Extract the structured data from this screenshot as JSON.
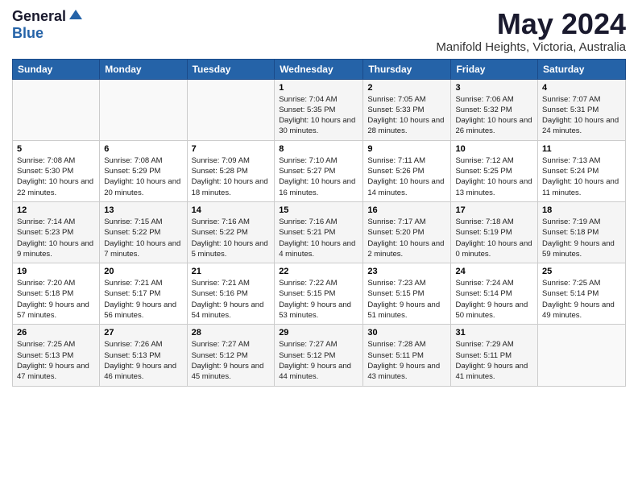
{
  "header": {
    "logo_general": "General",
    "logo_blue": "Blue",
    "month_title": "May 2024",
    "location": "Manifold Heights, Victoria, Australia"
  },
  "days_of_week": [
    "Sunday",
    "Monday",
    "Tuesday",
    "Wednesday",
    "Thursday",
    "Friday",
    "Saturday"
  ],
  "weeks": [
    [
      {
        "date": "",
        "info": ""
      },
      {
        "date": "",
        "info": ""
      },
      {
        "date": "",
        "info": ""
      },
      {
        "date": "1",
        "info": "Sunrise: 7:04 AM\nSunset: 5:35 PM\nDaylight: 10 hours and 30 minutes."
      },
      {
        "date": "2",
        "info": "Sunrise: 7:05 AM\nSunset: 5:33 PM\nDaylight: 10 hours and 28 minutes."
      },
      {
        "date": "3",
        "info": "Sunrise: 7:06 AM\nSunset: 5:32 PM\nDaylight: 10 hours and 26 minutes."
      },
      {
        "date": "4",
        "info": "Sunrise: 7:07 AM\nSunset: 5:31 PM\nDaylight: 10 hours and 24 minutes."
      }
    ],
    [
      {
        "date": "5",
        "info": "Sunrise: 7:08 AM\nSunset: 5:30 PM\nDaylight: 10 hours and 22 minutes."
      },
      {
        "date": "6",
        "info": "Sunrise: 7:08 AM\nSunset: 5:29 PM\nDaylight: 10 hours and 20 minutes."
      },
      {
        "date": "7",
        "info": "Sunrise: 7:09 AM\nSunset: 5:28 PM\nDaylight: 10 hours and 18 minutes."
      },
      {
        "date": "8",
        "info": "Sunrise: 7:10 AM\nSunset: 5:27 PM\nDaylight: 10 hours and 16 minutes."
      },
      {
        "date": "9",
        "info": "Sunrise: 7:11 AM\nSunset: 5:26 PM\nDaylight: 10 hours and 14 minutes."
      },
      {
        "date": "10",
        "info": "Sunrise: 7:12 AM\nSunset: 5:25 PM\nDaylight: 10 hours and 13 minutes."
      },
      {
        "date": "11",
        "info": "Sunrise: 7:13 AM\nSunset: 5:24 PM\nDaylight: 10 hours and 11 minutes."
      }
    ],
    [
      {
        "date": "12",
        "info": "Sunrise: 7:14 AM\nSunset: 5:23 PM\nDaylight: 10 hours and 9 minutes."
      },
      {
        "date": "13",
        "info": "Sunrise: 7:15 AM\nSunset: 5:22 PM\nDaylight: 10 hours and 7 minutes."
      },
      {
        "date": "14",
        "info": "Sunrise: 7:16 AM\nSunset: 5:22 PM\nDaylight: 10 hours and 5 minutes."
      },
      {
        "date": "15",
        "info": "Sunrise: 7:16 AM\nSunset: 5:21 PM\nDaylight: 10 hours and 4 minutes."
      },
      {
        "date": "16",
        "info": "Sunrise: 7:17 AM\nSunset: 5:20 PM\nDaylight: 10 hours and 2 minutes."
      },
      {
        "date": "17",
        "info": "Sunrise: 7:18 AM\nSunset: 5:19 PM\nDaylight: 10 hours and 0 minutes."
      },
      {
        "date": "18",
        "info": "Sunrise: 7:19 AM\nSunset: 5:18 PM\nDaylight: 9 hours and 59 minutes."
      }
    ],
    [
      {
        "date": "19",
        "info": "Sunrise: 7:20 AM\nSunset: 5:18 PM\nDaylight: 9 hours and 57 minutes."
      },
      {
        "date": "20",
        "info": "Sunrise: 7:21 AM\nSunset: 5:17 PM\nDaylight: 9 hours and 56 minutes."
      },
      {
        "date": "21",
        "info": "Sunrise: 7:21 AM\nSunset: 5:16 PM\nDaylight: 9 hours and 54 minutes."
      },
      {
        "date": "22",
        "info": "Sunrise: 7:22 AM\nSunset: 5:15 PM\nDaylight: 9 hours and 53 minutes."
      },
      {
        "date": "23",
        "info": "Sunrise: 7:23 AM\nSunset: 5:15 PM\nDaylight: 9 hours and 51 minutes."
      },
      {
        "date": "24",
        "info": "Sunrise: 7:24 AM\nSunset: 5:14 PM\nDaylight: 9 hours and 50 minutes."
      },
      {
        "date": "25",
        "info": "Sunrise: 7:25 AM\nSunset: 5:14 PM\nDaylight: 9 hours and 49 minutes."
      }
    ],
    [
      {
        "date": "26",
        "info": "Sunrise: 7:25 AM\nSunset: 5:13 PM\nDaylight: 9 hours and 47 minutes."
      },
      {
        "date": "27",
        "info": "Sunrise: 7:26 AM\nSunset: 5:13 PM\nDaylight: 9 hours and 46 minutes."
      },
      {
        "date": "28",
        "info": "Sunrise: 7:27 AM\nSunset: 5:12 PM\nDaylight: 9 hours and 45 minutes."
      },
      {
        "date": "29",
        "info": "Sunrise: 7:27 AM\nSunset: 5:12 PM\nDaylight: 9 hours and 44 minutes."
      },
      {
        "date": "30",
        "info": "Sunrise: 7:28 AM\nSunset: 5:11 PM\nDaylight: 9 hours and 43 minutes."
      },
      {
        "date": "31",
        "info": "Sunrise: 7:29 AM\nSunset: 5:11 PM\nDaylight: 9 hours and 41 minutes."
      },
      {
        "date": "",
        "info": ""
      }
    ]
  ],
  "colors": {
    "header_bg": "#2563a8",
    "header_text": "#ffffff",
    "odd_row_bg": "#f5f5f5",
    "even_row_bg": "#ffffff"
  }
}
